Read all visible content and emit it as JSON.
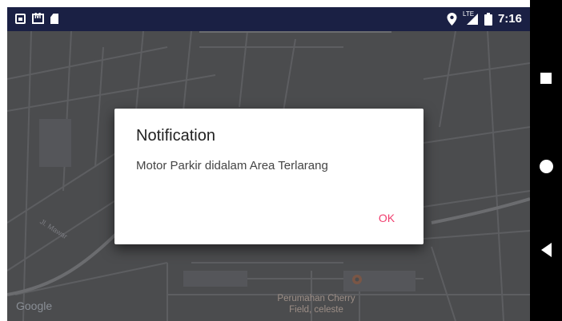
{
  "statusbar": {
    "time": "7:16",
    "network_label": "LTE",
    "left_icons": [
      "notification-a-icon",
      "gmail-icon",
      "sd-card-icon"
    ],
    "right_icons": [
      "location-icon",
      "signal-icon",
      "battery-icon"
    ]
  },
  "map": {
    "poi_label": "Perumahan Cherry Field, celeste",
    "street_label": "Jl. Mawar",
    "attribution": "Google"
  },
  "dialog": {
    "title": "Notification",
    "message": "Motor Parkir didalam Area Terlarang",
    "ok_label": "OK",
    "ok_color": "#f03e6e"
  },
  "navbar": {
    "buttons": [
      "recents-icon",
      "home-icon",
      "back-icon"
    ]
  },
  "colors": {
    "statusbar_bg": "#1a2044",
    "map_dim": "#4b4c4e",
    "dialog_bg": "#ffffff"
  }
}
